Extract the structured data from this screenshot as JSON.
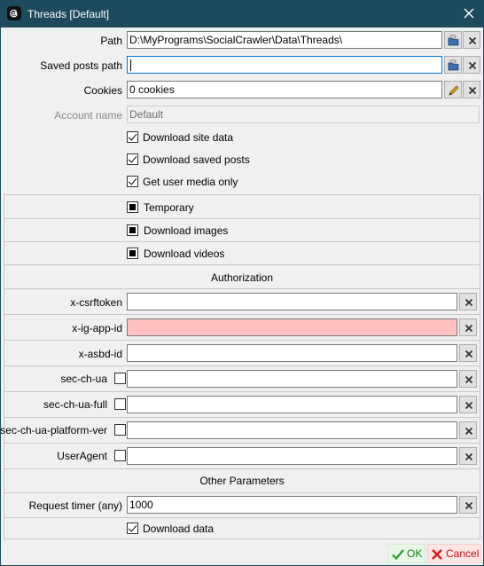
{
  "window": {
    "title": "Threads [Default]",
    "icon": "threads-logo-icon"
  },
  "fields": {
    "path": {
      "label": "Path",
      "value": "D:\\MyPrograms\\SocialCrawler\\Data\\Threads\\"
    },
    "saved_posts_path": {
      "label": "Saved posts path",
      "value": ""
    },
    "cookies": {
      "label": "Cookies",
      "value": "0 cookies"
    },
    "account_name": {
      "label": "Account name",
      "value": "Default"
    }
  },
  "options": {
    "download_site_data": {
      "label": "Download site data",
      "state": "checked"
    },
    "download_saved_posts": {
      "label": "Download saved posts",
      "state": "checked"
    },
    "get_user_media_only": {
      "label": "Get user media only",
      "state": "checked"
    },
    "temporary": {
      "label": "Temporary",
      "state": "indeterminate"
    },
    "download_images": {
      "label": "Download images",
      "state": "indeterminate"
    },
    "download_videos": {
      "label": "Download videos",
      "state": "indeterminate"
    }
  },
  "authorization": {
    "header": "Authorization",
    "x_csrftoken": {
      "label": "x-csrftoken",
      "value": ""
    },
    "x_ig_app_id": {
      "label": "x-ig-app-id",
      "value": ""
    },
    "x_asbd_id": {
      "label": "x-asbd-id",
      "value": ""
    },
    "sec_ch_ua": {
      "label": "sec-ch-ua",
      "value": "",
      "checked": false
    },
    "sec_ch_ua_full": {
      "label": "sec-ch-ua-full",
      "value": "",
      "checked": false
    },
    "sec_ch_ua_platform_ver": {
      "label": "sec-ch-ua-platform-ver",
      "value": "",
      "checked": false
    },
    "user_agent": {
      "label": "UserAgent",
      "value": "",
      "checked": false
    }
  },
  "other": {
    "header": "Other Parameters",
    "request_timer": {
      "label": "Request timer (any)",
      "value": "1000"
    },
    "download_data": {
      "label": "Download data",
      "state": "checked"
    }
  },
  "buttons": {
    "ok": "OK",
    "cancel": "Cancel"
  },
  "colors": {
    "titlebar": "#1e4a5e",
    "error_field": "#ffc0c0",
    "focus_border": "#0078d7"
  }
}
